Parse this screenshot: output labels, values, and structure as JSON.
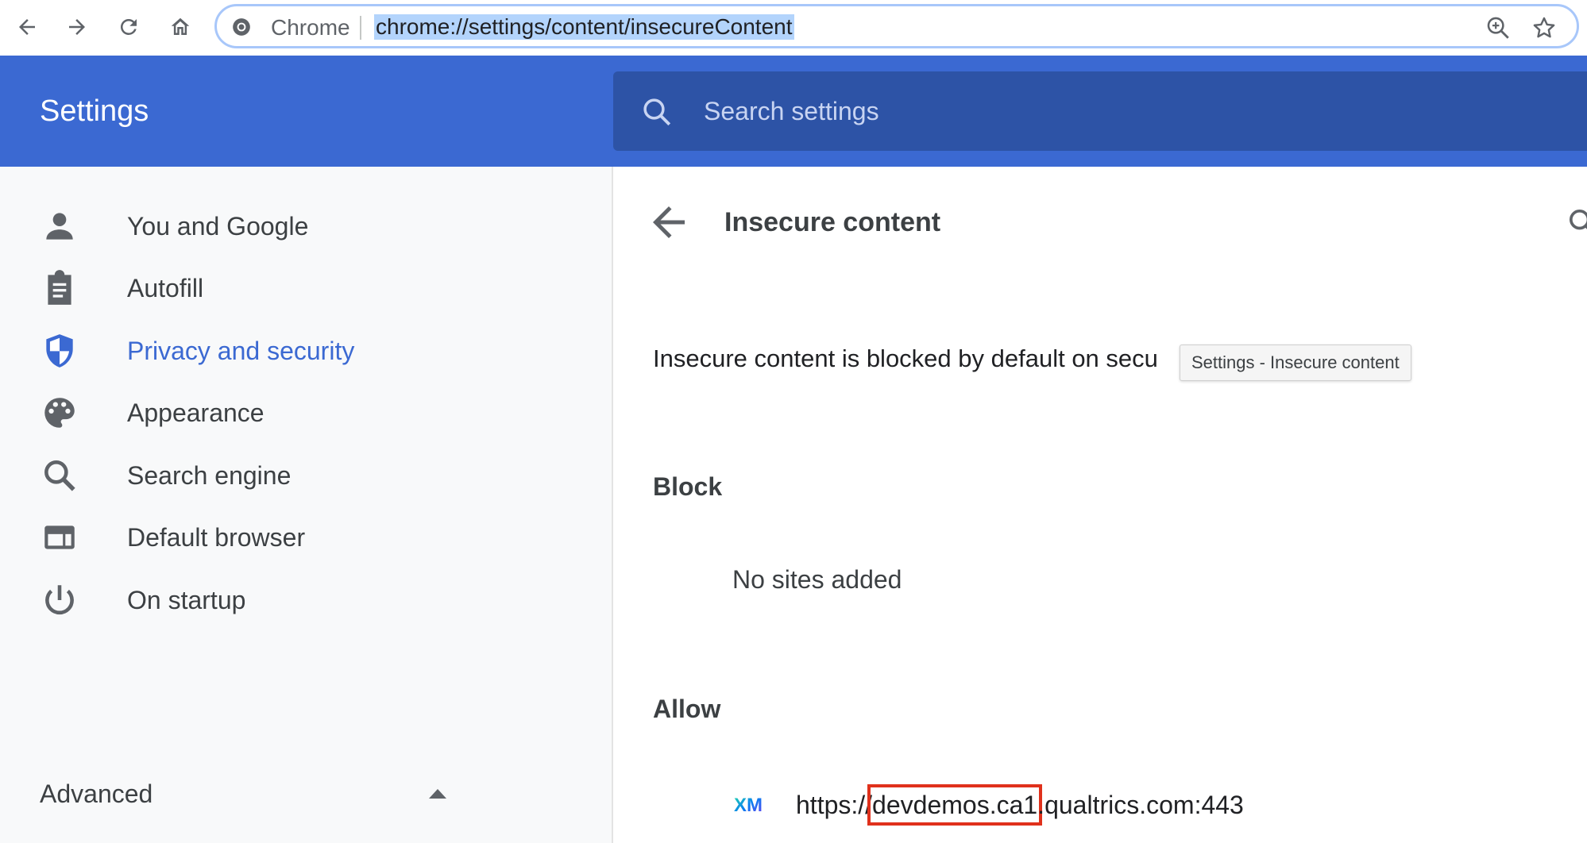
{
  "browser": {
    "origin_label": "Chrome",
    "url": "chrome://settings/content/insecureContent",
    "buttons": {
      "back": "arrow-left-icon",
      "forward": "arrow-right-icon",
      "reload": "reload-icon",
      "home": "home-icon"
    }
  },
  "header": {
    "title": "Settings",
    "search_placeholder": "Search settings"
  },
  "sidebar": {
    "items": [
      {
        "label": "You and Google",
        "icon": "person-icon"
      },
      {
        "label": "Autofill",
        "icon": "clipboard-icon"
      },
      {
        "label": "Privacy and security",
        "icon": "shield-icon",
        "active": true
      },
      {
        "label": "Appearance",
        "icon": "palette-icon"
      },
      {
        "label": "Search engine",
        "icon": "search-icon"
      },
      {
        "label": "Default browser",
        "icon": "browser-window-icon"
      },
      {
        "label": "On startup",
        "icon": "power-icon"
      }
    ],
    "advanced_label": "Advanced"
  },
  "main": {
    "title": "Insecure content",
    "description": "Insecure content is blocked by default on secu",
    "tooltip": "Settings - Insecure content",
    "block_title": "Block",
    "block_empty": "No sites added",
    "allow_title": "Allow",
    "allow_sites": [
      {
        "favicon_text": "XM",
        "url_prefix": "https://",
        "url_highlight": "devdemos.ca1",
        "url_suffix": ".qualtrics.com:443"
      }
    ]
  },
  "colors": {
    "header_blue": "#3b69d2",
    "search_blue": "#2d53a6",
    "active_blue": "#3b69d2",
    "highlight_red": "#e0311c"
  }
}
